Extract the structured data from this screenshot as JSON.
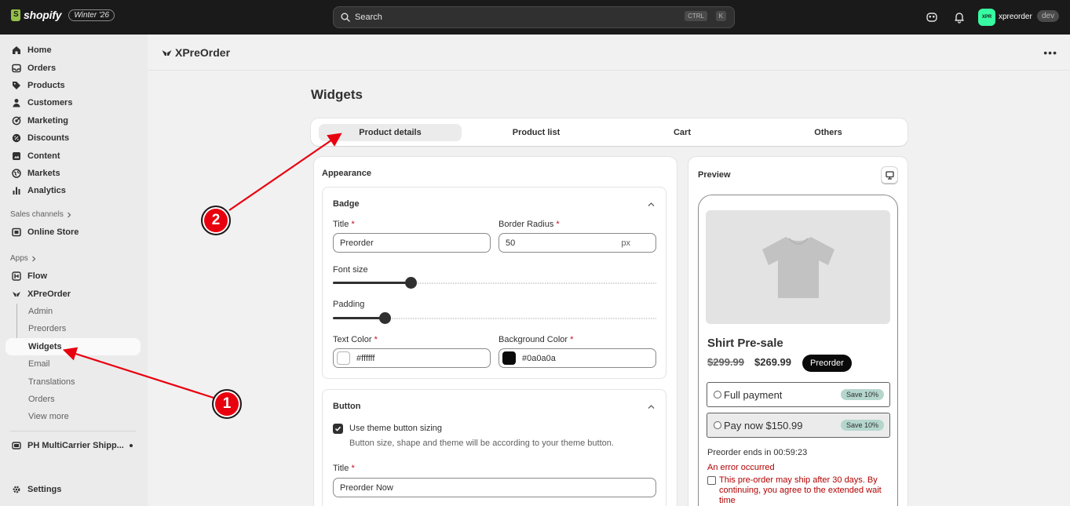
{
  "topbar": {
    "brand": "shopify",
    "version": "Winter '26",
    "search_placeholder": "Search",
    "kbd_ctrl": "CTRL",
    "kbd_k": "K",
    "store_initials": "XPR",
    "store_name": "xpreorder",
    "store_badge": "dev"
  },
  "sidebar": {
    "main_items": [
      {
        "label": "Home",
        "icon": "home-icon"
      },
      {
        "label": "Orders",
        "icon": "inbox-icon"
      },
      {
        "label": "Products",
        "icon": "tag-icon"
      },
      {
        "label": "Customers",
        "icon": "person-icon"
      },
      {
        "label": "Marketing",
        "icon": "target-icon"
      },
      {
        "label": "Discounts",
        "icon": "discount-icon"
      },
      {
        "label": "Content",
        "icon": "content-icon"
      },
      {
        "label": "Markets",
        "icon": "globe-icon"
      },
      {
        "label": "Analytics",
        "icon": "bar-chart-icon"
      }
    ],
    "sales_channels_label": "Sales channels",
    "online_store": "Online Store",
    "apps_label": "Apps",
    "flow": "Flow",
    "xpreorder": "XPreOrder",
    "sub_items": [
      "Admin",
      "Preorders",
      "Widgets",
      "Email",
      "Translations",
      "Orders",
      "View more"
    ],
    "ph_app": "PH MultiCarrier Shipp...",
    "settings": "Settings"
  },
  "app": {
    "title": "XPreOrder",
    "more": "•••"
  },
  "page": {
    "title": "Widgets",
    "tabs": [
      "Product details",
      "Product list",
      "Cart",
      "Others"
    ]
  },
  "appearance": {
    "title": "Appearance",
    "badge": {
      "title": "Badge",
      "title_label": "Title",
      "title_value": "Preorder",
      "radius_label": "Border Radius",
      "radius_value": "50",
      "radius_suffix": "px",
      "font_size_label": "Font size",
      "font_size_level": 0.24,
      "padding_label": "Padding",
      "padding_level": 0.16,
      "text_color_label": "Text Color",
      "text_color_value": "#ffffff",
      "bg_color_label": "Background Color",
      "bg_color_value": "#0a0a0a",
      "required": "*"
    },
    "button": {
      "title": "Button",
      "theme_sizing_label": "Use theme button sizing",
      "theme_sizing_help": "Button size, shape and theme will be according to your theme button.",
      "theme_sizing_checked": true,
      "title_label": "Title",
      "title_value": "Preorder Now"
    }
  },
  "preview": {
    "title": "Preview",
    "product_title": "Shirt Pre-sale",
    "old_price": "$299.99",
    "new_price": "$269.99",
    "badge": "Preorder",
    "option_full": "Full payment",
    "option_partial": "Pay now $150.99",
    "save_label": "Save 10%",
    "ends_text": "Preorder ends in 00:59:23",
    "error_text": "An error occurred",
    "consent_text": "This pre-order may ship after 30 days. By continuing, you agree to the extended wait time"
  },
  "annotations": {
    "marker_1": "1",
    "marker_2": "2",
    "color": "#e8000e"
  }
}
